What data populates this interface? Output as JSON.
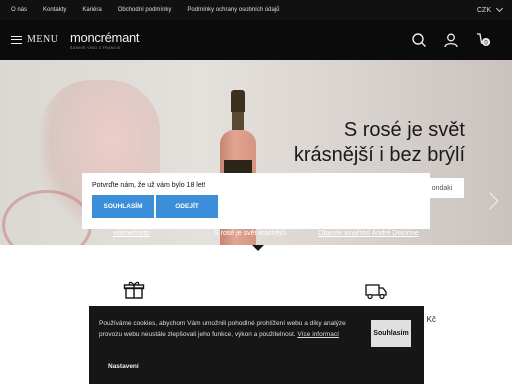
{
  "topbar": {
    "links": [
      "O nás",
      "Kontakty",
      "Kariéra",
      "Obchodní podmínky",
      "Podmínky ochrany osobních údajů"
    ],
    "currency": "CZK"
  },
  "header": {
    "menu_label": "MENU",
    "logo_name": "moncrémant",
    "logo_tagline": "ŠUMIVÉ VÍNO Z FRANCIE",
    "cart_count": "0"
  },
  "hero": {
    "title_line1": "S rosé je svět",
    "title_line2": "krásnější i bez brýlí",
    "button_label": "ondaki"
  },
  "slider_tabs": [
    "výjimečným",
    "S rosé je svět krásnější",
    "Objevte vinařství André Delorme"
  ],
  "promo": {
    "right_text": "Kč"
  },
  "age_modal": {
    "question": "Potvrďte nám, že už vám bylo 18 let!",
    "confirm_label": "SOUHLASÍM",
    "leave_label": "ODEJÍT"
  },
  "cookie": {
    "text": "Používáme cookies, abychom Vám umožnili pohodlné prohlížení webu a díky analýze provozu webu neustále zlepšovali jeho funkce, výkon a použitelnost.",
    "more_label": "Více informací",
    "accept_label": "Souhlasím",
    "settings_label": "Nastavení"
  },
  "colors": {
    "accent": "#3a8fd8",
    "header_bg": "#0b0b0b",
    "cookie_bg": "#161616"
  }
}
